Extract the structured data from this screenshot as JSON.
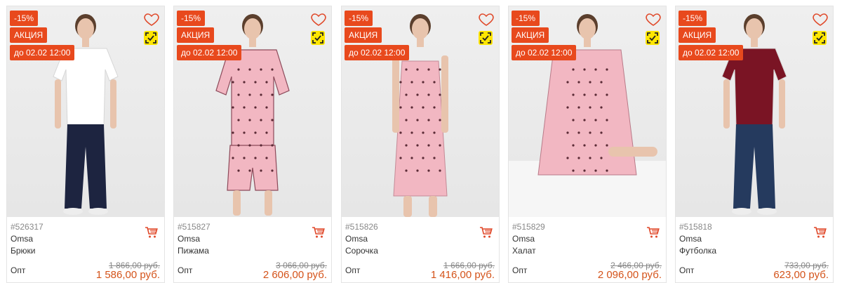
{
  "colors": {
    "badge": "#e8491d",
    "price": "#d4531a",
    "scan_bg": "#ffe600"
  },
  "products": [
    {
      "discount": "-15%",
      "promo": "АКЦИЯ",
      "until": "до 02.02 12:00",
      "sku": "#526317",
      "brand": "Omsa",
      "name": "Брюки",
      "opt": "Опт",
      "old_price": "1 866,00 руб.",
      "price": "1 586,00 руб.",
      "garment": "tee-pants",
      "top_color": "#ffffff",
      "bottom_color": "#1d2440"
    },
    {
      "discount": "-15%",
      "promo": "АКЦИЯ",
      "until": "до 02.02 12:00",
      "sku": "#515827",
      "brand": "Omsa",
      "name": "Пижама",
      "opt": "Опт",
      "old_price": "3 066,00 руб.",
      "price": "2 606,00 руб.",
      "garment": "pajama",
      "top_color": "#f2b7c2",
      "bottom_color": "#f2b7c2"
    },
    {
      "discount": "-15%",
      "promo": "АКЦИЯ",
      "until": "до 02.02 12:00",
      "sku": "#515826",
      "brand": "Omsa",
      "name": "Сорочка",
      "opt": "Опт",
      "old_price": "1 666,00 руб.",
      "price": "1 416,00 руб.",
      "garment": "slip",
      "top_color": "#f2b7c2",
      "bottom_color": "#f2b7c2"
    },
    {
      "discount": "-15%",
      "promo": "АКЦИЯ",
      "until": "до 02.02 12:00",
      "sku": "#515829",
      "brand": "Omsa",
      "name": "Халат",
      "opt": "Опт",
      "old_price": "2 466,00 руб.",
      "price": "2 096,00 руб.",
      "garment": "robe",
      "top_color": "#f2b7c2",
      "bottom_color": "#f2b7c2"
    },
    {
      "discount": "-15%",
      "promo": "АКЦИЯ",
      "until": "до 02.02 12:00",
      "sku": "#515818",
      "brand": "Omsa",
      "name": "Футболка",
      "opt": "Опт",
      "old_price": "733,00 руб.",
      "price": "623,00 руб.",
      "garment": "tee-jeans",
      "top_color": "#7a1424",
      "bottom_color": "#253a5e"
    }
  ]
}
